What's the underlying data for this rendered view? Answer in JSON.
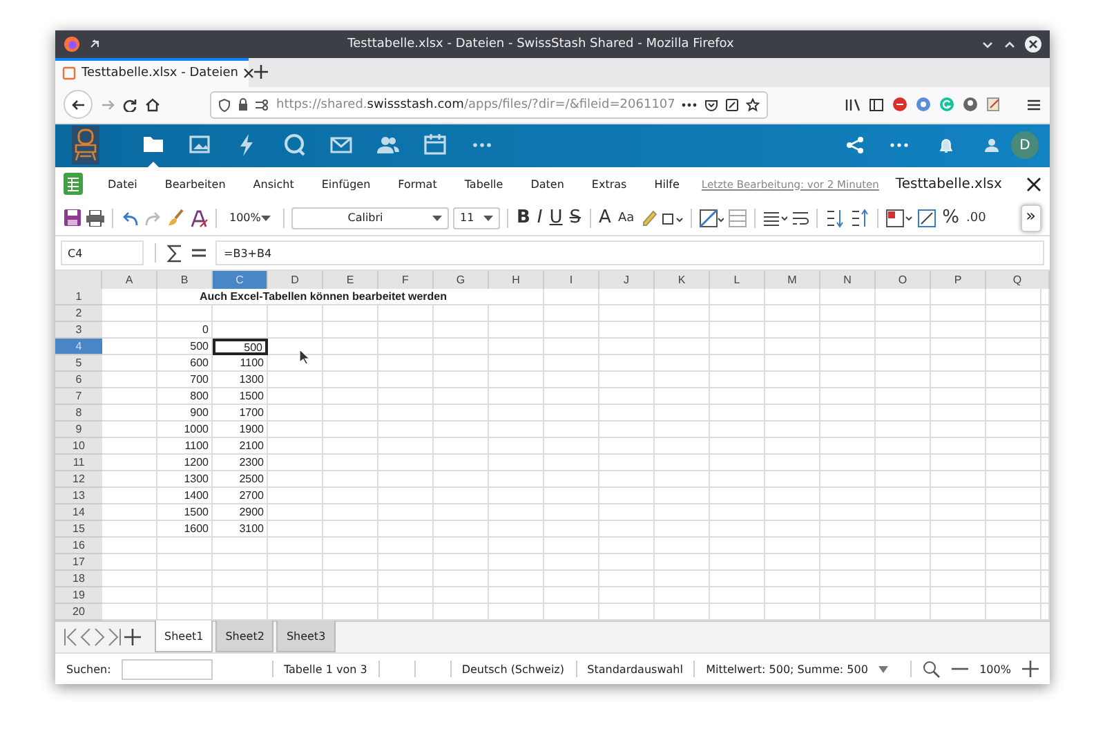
{
  "window": {
    "title": "Testtabelle.xlsx - Dateien - SwissStash Shared - Mozilla Firefox"
  },
  "browser_tab": {
    "title": "Testtabelle.xlsx - Dateien",
    "selected": true
  },
  "address_bar": {
    "prefix": "https://shared.",
    "domain": "swissstash.com",
    "path": "/apps/files/?dir=/&fileid=2061107"
  },
  "app_nav": [
    {
      "selected": true
    },
    {
      "selected": false
    },
    {
      "selected": false
    },
    {
      "selected": false
    },
    {
      "selected": false
    },
    {
      "selected": false
    },
    {
      "selected": false
    },
    {
      "selected": false
    }
  ],
  "avatar": "D",
  "menu": [
    "Datei",
    "Bearbeiten",
    "Ansicht",
    "Einfügen",
    "Format",
    "Tabelle",
    "Daten",
    "Extras",
    "Hilfe"
  ],
  "last_edit": "Letzte Bearbeitung: vor 2 Minuten",
  "document_title": "Testtabelle.xlsx",
  "toolbar": {
    "zoom": "100%",
    "font": "Calibri",
    "size": "11",
    "bold": "B",
    "italic": "I",
    "underline": "U",
    "strike": "S",
    "font_color": "A",
    "case": "Aa",
    "percent": "%",
    "decimals": ".00",
    "overflow": "»"
  },
  "formula_bar": {
    "cell": "C4",
    "formula": "=B3+B4"
  },
  "columns": [
    {
      "label": "A",
      "selected": false
    },
    {
      "label": "B",
      "selected": false
    },
    {
      "label": "C",
      "selected": true
    },
    {
      "label": "D",
      "selected": false
    },
    {
      "label": "E",
      "selected": false
    },
    {
      "label": "F",
      "selected": false
    },
    {
      "label": "G",
      "selected": false
    },
    {
      "label": "H",
      "selected": false
    },
    {
      "label": "I",
      "selected": false
    },
    {
      "label": "J",
      "selected": false
    },
    {
      "label": "K",
      "selected": false
    },
    {
      "label": "L",
      "selected": false
    },
    {
      "label": "M",
      "selected": false
    },
    {
      "label": "N",
      "selected": false
    },
    {
      "label": "O",
      "selected": false
    },
    {
      "label": "P",
      "selected": false
    },
    {
      "label": "Q",
      "selected": false
    }
  ],
  "rows": [
    {
      "header": "1",
      "selected": false,
      "title": "Auch Excel-Tabellen können bearbeitet werden"
    },
    {
      "header": "2",
      "selected": false
    },
    {
      "header": "3",
      "selected": false,
      "column_b": "0"
    },
    {
      "header": "4",
      "selected": true,
      "column_b": "500",
      "column_c": "500"
    },
    {
      "header": "5",
      "selected": false,
      "column_b": "600",
      "column_c": "1100"
    },
    {
      "header": "6",
      "selected": false,
      "column_b": "700",
      "column_c": "1300"
    },
    {
      "header": "7",
      "selected": false,
      "column_b": "800",
      "column_c": "1500"
    },
    {
      "header": "8",
      "selected": false,
      "column_b": "900",
      "column_c": "1700"
    },
    {
      "header": "9",
      "selected": false,
      "column_b": "1000",
      "column_c": "1900"
    },
    {
      "header": "10",
      "selected": false,
      "column_b": "1100",
      "column_c": "2100"
    },
    {
      "header": "11",
      "selected": false,
      "column_b": "1200",
      "column_c": "2300"
    },
    {
      "header": "12",
      "selected": false,
      "column_b": "1300",
      "column_c": "2500"
    },
    {
      "header": "13",
      "selected": false,
      "column_b": "1400",
      "column_c": "2700"
    },
    {
      "header": "14",
      "selected": false,
      "column_b": "1500",
      "column_c": "2900"
    },
    {
      "header": "15",
      "selected": false,
      "column_b": "1600",
      "column_c": "3100"
    },
    {
      "header": "16",
      "selected": false
    },
    {
      "header": "17",
      "selected": false
    },
    {
      "header": "18",
      "selected": false
    },
    {
      "header": "19",
      "selected": false
    },
    {
      "header": "20",
      "selected": false
    }
  ],
  "sheets": [
    {
      "label": "Sheet1",
      "selected": true
    },
    {
      "label": "Sheet2",
      "selected": false
    },
    {
      "label": "Sheet3",
      "selected": false
    }
  ],
  "status_bar": {
    "search_label": "Suchen:",
    "sheet_info": "Tabelle 1 von 3",
    "language": "Deutsch (Schweiz)",
    "selection_mode": "Standardauswahl",
    "summary": "Mittelwert: 500; Summe: 500",
    "zoom": "100%"
  }
}
